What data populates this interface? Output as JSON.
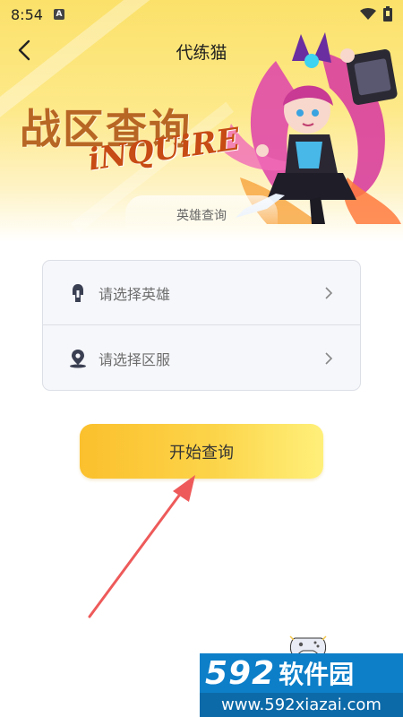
{
  "status_bar": {
    "time": "8:54",
    "notification_badge": "A"
  },
  "nav": {
    "title": "代练猫"
  },
  "hero": {
    "heading": "战区查询",
    "subheading": "iNQUiRE"
  },
  "section": {
    "label": "英雄查询"
  },
  "form": {
    "hero_select_placeholder": "请选择英雄",
    "server_select_placeholder": "请选择区服"
  },
  "actions": {
    "start_query_label": "开始查询"
  },
  "watermark": {
    "numbers": "592",
    "name": "软件园",
    "url": "www.592xiazai.com"
  },
  "colors": {
    "accent": "#fbc02d",
    "hero_bg": "#fbe16a",
    "watermark_blue": "#0d7fc9",
    "arrow_red": "#ee5a5a"
  },
  "icons": [
    "back-icon",
    "wifi-icon",
    "battery-icon",
    "hero-helmet-icon",
    "location-pin-icon",
    "chevron-right-icon",
    "game-controller-icon"
  ]
}
